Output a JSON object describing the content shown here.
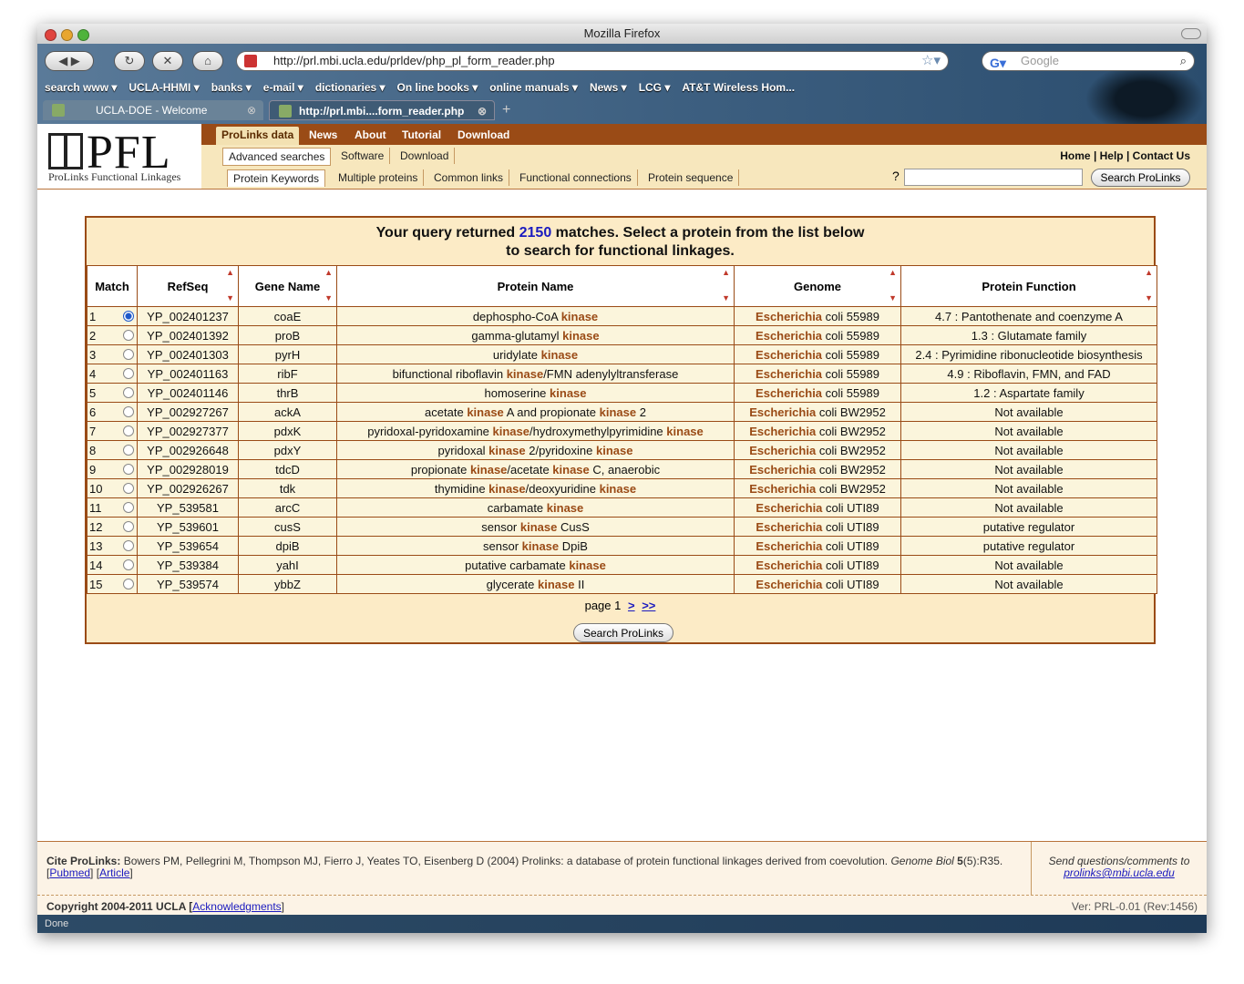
{
  "window": {
    "title": "Mozilla Firefox",
    "status": "Done"
  },
  "toolbar": {
    "url": "http://prl.mbi.ucla.edu/prldev/php_pl_form_reader.php",
    "search_placeholder": "Google"
  },
  "bookmarks": [
    "search www ▾",
    "UCLA-HHMI ▾",
    "banks ▾",
    "e-mail ▾",
    "dictionaries ▾",
    "On line books ▾",
    "online manuals ▾",
    "News ▾",
    "LCG ▾",
    "AT&T Wireless Hom..."
  ],
  "tabs": [
    {
      "label": "UCLA-DOE - Welcome"
    },
    {
      "label": "http://prl.mbi....form_reader.php"
    }
  ],
  "logo": {
    "text": "PFL",
    "subtitle": "ProLinks Functional Linkages"
  },
  "nav_primary": [
    "ProLinks data",
    "News",
    "About",
    "Tutorial",
    "Download"
  ],
  "nav_secondary": [
    "Advanced searches",
    "Software",
    "Download"
  ],
  "nav_tertiary": [
    "Protein Keywords",
    "Multiple proteins",
    "Common links",
    "Functional connections",
    "Protein sequence"
  ],
  "top_links": "Home | Help | Contact Us",
  "search": {
    "help": "?",
    "button": "Search ProLinks"
  },
  "results": {
    "line1_pre": "Your query returned ",
    "count": "2150",
    "line1_post": " matches. Select a protein from the list below",
    "line2": "to search for functional linkages.",
    "columns": [
      "Match",
      "RefSeq",
      "Gene Name",
      "Protein Name",
      "Genome",
      "Protein Function"
    ],
    "rows": [
      {
        "n": "1",
        "selected": true,
        "refseq": "YP_002401237",
        "gene": "coaE",
        "protein": [
          "dephospho-CoA ",
          "kinase"
        ],
        "genus": "Escherichia",
        "genome": " coli 55989",
        "function": "4.7 : Pantothenate and coenzyme A"
      },
      {
        "n": "2",
        "selected": false,
        "refseq": "YP_002401392",
        "gene": "proB",
        "protein": [
          "gamma-glutamyl ",
          "kinase"
        ],
        "genus": "Escherichia",
        "genome": " coli 55989",
        "function": "1.3 : Glutamate family"
      },
      {
        "n": "3",
        "selected": false,
        "refseq": "YP_002401303",
        "gene": "pyrH",
        "protein": [
          "uridylate ",
          "kinase"
        ],
        "genus": "Escherichia",
        "genome": " coli 55989",
        "function": "2.4 : Pyrimidine ribonucleotide biosynthesis"
      },
      {
        "n": "4",
        "selected": false,
        "refseq": "YP_002401163",
        "gene": "ribF",
        "protein": [
          "bifunctional riboflavin ",
          "kinase",
          "/FMN adenylyltransferase"
        ],
        "genus": "Escherichia",
        "genome": " coli 55989",
        "function": "4.9 : Riboflavin, FMN, and FAD"
      },
      {
        "n": "5",
        "selected": false,
        "refseq": "YP_002401146",
        "gene": "thrB",
        "protein": [
          "homoserine ",
          "kinase"
        ],
        "genus": "Escherichia",
        "genome": " coli 55989",
        "function": "1.2 : Aspartate family"
      },
      {
        "n": "6",
        "selected": false,
        "refseq": "YP_002927267",
        "gene": "ackA",
        "protein": [
          "acetate ",
          "kinase",
          " A and propionate ",
          "kinase",
          " 2"
        ],
        "genus": "Escherichia",
        "genome": " coli BW2952",
        "function": "Not available"
      },
      {
        "n": "7",
        "selected": false,
        "refseq": "YP_002927377",
        "gene": "pdxK",
        "protein": [
          "pyridoxal-pyridoxamine ",
          "kinase",
          "/hydroxymethylpyrimidine ",
          "kinase"
        ],
        "genus": "Escherichia",
        "genome": " coli BW2952",
        "function": "Not available"
      },
      {
        "n": "8",
        "selected": false,
        "refseq": "YP_002926648",
        "gene": "pdxY",
        "protein": [
          "pyridoxal ",
          "kinase",
          " 2/pyridoxine ",
          "kinase"
        ],
        "genus": "Escherichia",
        "genome": " coli BW2952",
        "function": "Not available"
      },
      {
        "n": "9",
        "selected": false,
        "refseq": "YP_002928019",
        "gene": "tdcD",
        "protein": [
          "propionate ",
          "kinase",
          "/acetate ",
          "kinase",
          " C, anaerobic"
        ],
        "genus": "Escherichia",
        "genome": " coli BW2952",
        "function": "Not available"
      },
      {
        "n": "10",
        "selected": false,
        "refseq": "YP_002926267",
        "gene": "tdk",
        "protein": [
          "thymidine ",
          "kinase",
          "/deoxyuridine ",
          "kinase"
        ],
        "genus": "Escherichia",
        "genome": " coli BW2952",
        "function": "Not available"
      },
      {
        "n": "11",
        "selected": false,
        "refseq": "YP_539581",
        "gene": "arcC",
        "protein": [
          "carbamate ",
          "kinase"
        ],
        "genus": "Escherichia",
        "genome": " coli UTI89",
        "function": "Not available"
      },
      {
        "n": "12",
        "selected": false,
        "refseq": "YP_539601",
        "gene": "cusS",
        "protein": [
          "sensor ",
          "kinase",
          " CusS"
        ],
        "genus": "Escherichia",
        "genome": " coli UTI89",
        "function": "putative regulator"
      },
      {
        "n": "13",
        "selected": false,
        "refseq": "YP_539654",
        "gene": "dpiB",
        "protein": [
          "sensor ",
          "kinase",
          " DpiB"
        ],
        "genus": "Escherichia",
        "genome": " coli UTI89",
        "function": "putative regulator"
      },
      {
        "n": "14",
        "selected": false,
        "refseq": "YP_539384",
        "gene": "yahI",
        "protein": [
          "putative carbamate ",
          "kinase"
        ],
        "genus": "Escherichia",
        "genome": " coli UTI89",
        "function": "Not available"
      },
      {
        "n": "15",
        "selected": false,
        "refseq": "YP_539574",
        "gene": "ybbZ",
        "protein": [
          "glycerate ",
          "kinase",
          " II"
        ],
        "genus": "Escherichia",
        "genome": " coli UTI89",
        "function": "Not available"
      }
    ],
    "pager": {
      "label": "page 1",
      "next": ">",
      "last": ">>"
    },
    "button": "Search ProLinks"
  },
  "footer": {
    "cite_label": "Cite ProLinks:",
    "cite_text": " Bowers PM, Pellegrini M, Thompson MJ, Fierro J, Yeates TO, Eisenberg D (2004) Prolinks: a database of protein functional linkages derived from coevolution. ",
    "journal": "Genome Biol",
    "volume": "5",
    "issue": "(5):R35.",
    "pubmed": "Pubmed",
    "article": "Article",
    "contact_text": "Send questions/comments to",
    "contact_email": "prolinks@mbi.ucla.edu",
    "copyright": "Copyright 2004-2011 UCLA [",
    "ack": "Acknowledgments",
    "version": "Ver: PRL-0.01 (Rev:1456)"
  },
  "colors": {
    "brand": "#9a4b16",
    "panel": "#fcebc6",
    "link": "#1b1bbf"
  }
}
